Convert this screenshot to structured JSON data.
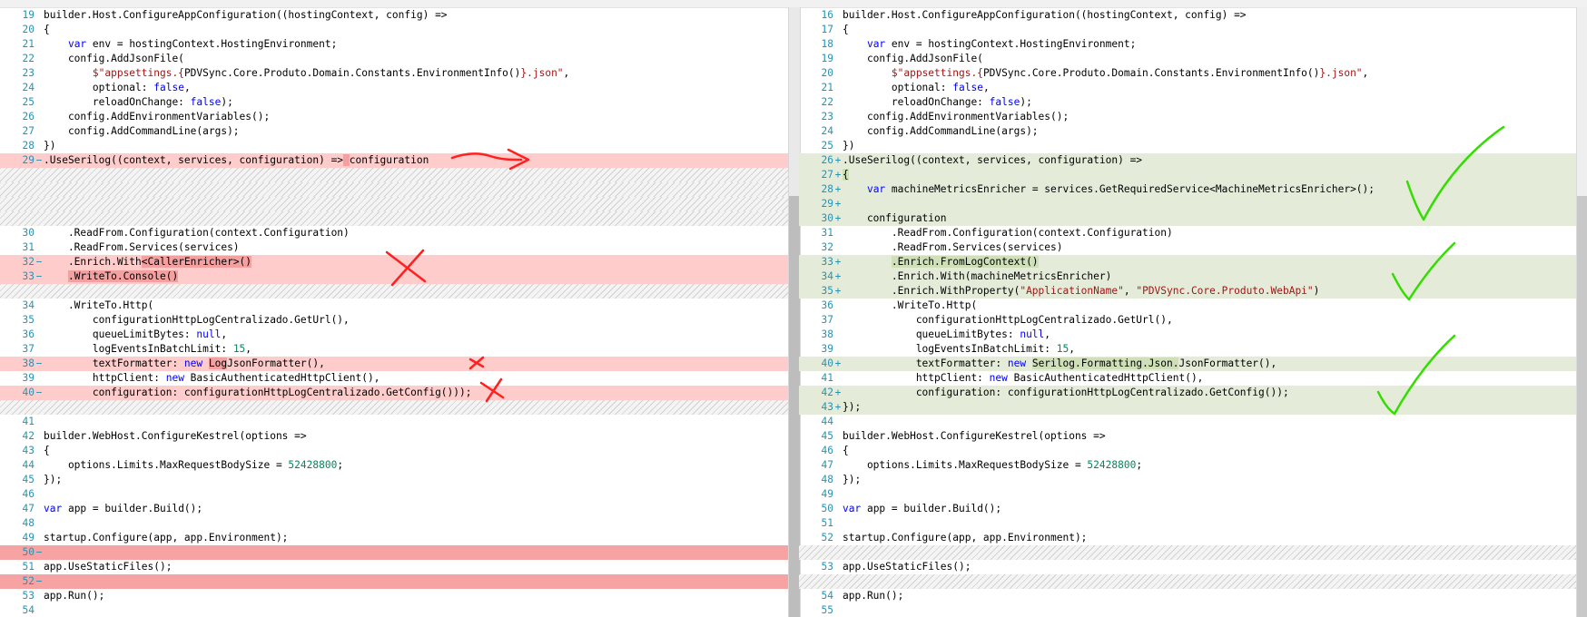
{
  "colors": {
    "deleted_line": "#ffcccc",
    "deleted_empty_line": "#f8a3a3",
    "added_line": "#e4ecd9",
    "line_number": "#2b91af",
    "keyword": "#0000ff",
    "string": "#a31515",
    "number": "#098658",
    "annotation_red": "#ff2020",
    "annotation_green": "#33dd00"
  },
  "icons": {
    "annotations": [
      "arrow-annotation-icon",
      "x-mark-annotation-icon",
      "check-mark-annotation-icon"
    ]
  },
  "left_pane": {
    "rows": [
      {
        "n": "19",
        "m": "",
        "type": "ctx",
        "segs": [
          [
            "p",
            "builder.Host.ConfigureAppConfiguration((hostingContext, config) =>"
          ]
        ]
      },
      {
        "n": "20",
        "m": "",
        "type": "ctx",
        "segs": [
          [
            "p",
            "{"
          ]
        ]
      },
      {
        "n": "21",
        "m": "",
        "type": "ctx",
        "segs": [
          [
            "p",
            "    "
          ],
          [
            "kw",
            "var"
          ],
          [
            "p",
            " env = hostingContext.HostingEnvironment;"
          ]
        ]
      },
      {
        "n": "22",
        "m": "",
        "type": "ctx",
        "segs": [
          [
            "p",
            "    config.AddJsonFile("
          ]
        ]
      },
      {
        "n": "23",
        "m": "",
        "type": "ctx",
        "segs": [
          [
            "p",
            "        "
          ],
          [
            "str",
            "$\"appsettings.{"
          ],
          [
            "p",
            "PDVSync.Core.Produto.Domain.Constants.EnvironmentInfo()"
          ],
          [
            "str",
            "}.json\""
          ],
          [
            "p",
            ","
          ]
        ]
      },
      {
        "n": "24",
        "m": "",
        "type": "ctx",
        "segs": [
          [
            "p",
            "        optional: "
          ],
          [
            "kw",
            "false"
          ],
          [
            "p",
            ","
          ]
        ]
      },
      {
        "n": "25",
        "m": "",
        "type": "ctx",
        "segs": [
          [
            "p",
            "        reloadOnChange: "
          ],
          [
            "kw",
            "false"
          ],
          [
            "p",
            ");"
          ]
        ]
      },
      {
        "n": "26",
        "m": "",
        "type": "ctx",
        "segs": [
          [
            "p",
            "    config.AddEnvironmentVariables();"
          ]
        ]
      },
      {
        "n": "27",
        "m": "",
        "type": "ctx",
        "segs": [
          [
            "p",
            "    config.AddCommandLine(args);"
          ]
        ]
      },
      {
        "n": "28",
        "m": "",
        "type": "ctx",
        "segs": [
          [
            "p",
            "})"
          ]
        ]
      },
      {
        "n": "29",
        "m": "−",
        "type": "del",
        "segs": [
          [
            "p",
            ".UseSerilog((context, services, configuration) =>"
          ],
          [
            "hd",
            " "
          ],
          [
            "p",
            "configuration"
          ]
        ]
      },
      {
        "n": "",
        "m": "",
        "type": "hatch",
        "segs": []
      },
      {
        "n": "",
        "m": "",
        "type": "hatch",
        "segs": []
      },
      {
        "n": "",
        "m": "",
        "type": "hatch",
        "segs": []
      },
      {
        "n": "",
        "m": "",
        "type": "hatch",
        "segs": []
      },
      {
        "n": "30",
        "m": "",
        "type": "ctx",
        "segs": [
          [
            "p",
            "    .ReadFrom.Configuration(context.Configuration)"
          ]
        ]
      },
      {
        "n": "31",
        "m": "",
        "type": "ctx",
        "segs": [
          [
            "p",
            "    .ReadFrom.Services(services)"
          ]
        ]
      },
      {
        "n": "32",
        "m": "−",
        "type": "del",
        "segs": [
          [
            "p",
            "    .Enrich.With"
          ],
          [
            "hd",
            "<CallerEnricher>()"
          ]
        ]
      },
      {
        "n": "33",
        "m": "−",
        "type": "del",
        "segs": [
          [
            "p",
            "    "
          ],
          [
            "hd",
            ".WriteTo.Console()"
          ]
        ]
      },
      {
        "n": "",
        "m": "",
        "type": "hatch",
        "segs": []
      },
      {
        "n": "34",
        "m": "",
        "type": "ctx",
        "segs": [
          [
            "p",
            "    .WriteTo.Http("
          ]
        ]
      },
      {
        "n": "35",
        "m": "",
        "type": "ctx",
        "segs": [
          [
            "p",
            "        configurationHttpLogCentralizado.GetUrl(),"
          ]
        ]
      },
      {
        "n": "36",
        "m": "",
        "type": "ctx",
        "segs": [
          [
            "p",
            "        queueLimitBytes: "
          ],
          [
            "kw",
            "null"
          ],
          [
            "p",
            ","
          ]
        ]
      },
      {
        "n": "37",
        "m": "",
        "type": "ctx",
        "segs": [
          [
            "p",
            "        logEventsInBatchLimit: "
          ],
          [
            "num",
            "15"
          ],
          [
            "p",
            ","
          ]
        ]
      },
      {
        "n": "38",
        "m": "−",
        "type": "del",
        "segs": [
          [
            "p",
            "        textFormatter: "
          ],
          [
            "kw",
            "new"
          ],
          [
            "p",
            " "
          ],
          [
            "hd",
            "Log"
          ],
          [
            "p",
            "JsonFormatter(),"
          ]
        ]
      },
      {
        "n": "39",
        "m": "",
        "type": "ctx",
        "segs": [
          [
            "p",
            "        httpClient: "
          ],
          [
            "kw",
            "new"
          ],
          [
            "p",
            " BasicAuthenticatedHttpClient(),"
          ]
        ]
      },
      {
        "n": "40",
        "m": "−",
        "type": "del",
        "segs": [
          [
            "p",
            "        configuration: configurationHttpLogCentralizado.GetConfig()));"
          ]
        ]
      },
      {
        "n": "",
        "m": "",
        "type": "hatch",
        "segs": []
      },
      {
        "n": "41",
        "m": "",
        "type": "ctx",
        "segs": []
      },
      {
        "n": "42",
        "m": "",
        "type": "ctx",
        "segs": [
          [
            "p",
            "builder.WebHost.ConfigureKestrel(options =>"
          ]
        ]
      },
      {
        "n": "43",
        "m": "",
        "type": "ctx",
        "segs": [
          [
            "p",
            "{"
          ]
        ]
      },
      {
        "n": "44",
        "m": "",
        "type": "ctx",
        "segs": [
          [
            "p",
            "    options.Limits.MaxRequestBodySize = "
          ],
          [
            "num",
            "52428800"
          ],
          [
            "p",
            ";"
          ]
        ]
      },
      {
        "n": "45",
        "m": "",
        "type": "ctx",
        "segs": [
          [
            "p",
            "});"
          ]
        ]
      },
      {
        "n": "46",
        "m": "",
        "type": "ctx",
        "segs": []
      },
      {
        "n": "47",
        "m": "",
        "type": "ctx",
        "segs": [
          [
            "kw",
            "var"
          ],
          [
            "p",
            " app = builder.Build();"
          ]
        ]
      },
      {
        "n": "48",
        "m": "",
        "type": "ctx",
        "segs": []
      },
      {
        "n": "49",
        "m": "",
        "type": "ctx",
        "segs": [
          [
            "p",
            "startup.Configure(app, app.Environment);"
          ]
        ]
      },
      {
        "n": "50",
        "m": "−",
        "type": "delempty",
        "segs": []
      },
      {
        "n": "51",
        "m": "",
        "type": "ctx",
        "segs": [
          [
            "p",
            "app.UseStaticFiles();"
          ]
        ]
      },
      {
        "n": "52",
        "m": "−",
        "type": "delempty",
        "segs": []
      },
      {
        "n": "53",
        "m": "",
        "type": "ctx",
        "segs": [
          [
            "p",
            "app.Run();"
          ]
        ]
      },
      {
        "n": "54",
        "m": "",
        "type": "ctx",
        "segs": []
      }
    ]
  },
  "right_pane": {
    "rows": [
      {
        "n": "16",
        "m": "",
        "type": "ctx",
        "segs": [
          [
            "p",
            "builder.Host.ConfigureAppConfiguration((hostingContext, config) =>"
          ]
        ]
      },
      {
        "n": "17",
        "m": "",
        "type": "ctx",
        "segs": [
          [
            "p",
            "{"
          ]
        ]
      },
      {
        "n": "18",
        "m": "",
        "type": "ctx",
        "segs": [
          [
            "p",
            "    "
          ],
          [
            "kw",
            "var"
          ],
          [
            "p",
            " env = hostingContext.HostingEnvironment;"
          ]
        ]
      },
      {
        "n": "19",
        "m": "",
        "type": "ctx",
        "segs": [
          [
            "p",
            "    config.AddJsonFile("
          ]
        ]
      },
      {
        "n": "20",
        "m": "",
        "type": "ctx",
        "segs": [
          [
            "p",
            "        "
          ],
          [
            "str",
            "$\"appsettings.{"
          ],
          [
            "p",
            "PDVSync.Core.Produto.Domain.Constants.EnvironmentInfo()"
          ],
          [
            "str",
            "}.json\""
          ],
          [
            "p",
            ","
          ]
        ]
      },
      {
        "n": "21",
        "m": "",
        "type": "ctx",
        "segs": [
          [
            "p",
            "        optional: "
          ],
          [
            "kw",
            "false"
          ],
          [
            "p",
            ","
          ]
        ]
      },
      {
        "n": "22",
        "m": "",
        "type": "ctx",
        "segs": [
          [
            "p",
            "        reloadOnChange: "
          ],
          [
            "kw",
            "false"
          ],
          [
            "p",
            ");"
          ]
        ]
      },
      {
        "n": "23",
        "m": "",
        "type": "ctx",
        "segs": [
          [
            "p",
            "    config.AddEnvironmentVariables();"
          ]
        ]
      },
      {
        "n": "24",
        "m": "",
        "type": "ctx",
        "segs": [
          [
            "p",
            "    config.AddCommandLine(args);"
          ]
        ]
      },
      {
        "n": "25",
        "m": "",
        "type": "ctx",
        "segs": [
          [
            "p",
            "})"
          ]
        ]
      },
      {
        "n": "26",
        "m": "+",
        "type": "add",
        "segs": [
          [
            "p",
            ".UseSerilog((context, services, configuration) =>"
          ]
        ]
      },
      {
        "n": "27",
        "m": "+",
        "type": "add",
        "segs": [
          [
            "ha",
            "{"
          ]
        ]
      },
      {
        "n": "28",
        "m": "+",
        "type": "add",
        "segs": [
          [
            "p",
            "    "
          ],
          [
            "kw",
            "var"
          ],
          [
            "p",
            " machineMetricsEnricher = services.GetRequiredService<MachineMetricsEnricher>();"
          ]
        ]
      },
      {
        "n": "29",
        "m": "+",
        "type": "add",
        "segs": []
      },
      {
        "n": "30",
        "m": "+",
        "type": "add",
        "segs": [
          [
            "p",
            "    configuration"
          ]
        ]
      },
      {
        "n": "31",
        "m": "",
        "type": "ctx",
        "segs": [
          [
            "p",
            "        .ReadFrom.Configuration(context.Configuration)"
          ]
        ]
      },
      {
        "n": "32",
        "m": "",
        "type": "ctx",
        "segs": [
          [
            "p",
            "        .ReadFrom.Services(services)"
          ]
        ]
      },
      {
        "n": "33",
        "m": "+",
        "type": "add",
        "segs": [
          [
            "p",
            "        "
          ],
          [
            "ha",
            ".Enrich.FromLogContext()"
          ]
        ]
      },
      {
        "n": "34",
        "m": "+",
        "type": "add",
        "segs": [
          [
            "p",
            "        .Enrich.With(machineMetricsEnricher)"
          ]
        ]
      },
      {
        "n": "35",
        "m": "+",
        "type": "add",
        "segs": [
          [
            "p",
            "        .Enrich.WithProperty("
          ],
          [
            "str",
            "\"ApplicationName\""
          ],
          [
            "p",
            ", "
          ],
          [
            "str",
            "\"PDVSync.Core.Produto.WebApi\""
          ],
          [
            "p",
            ")"
          ]
        ]
      },
      {
        "n": "36",
        "m": "",
        "type": "ctx",
        "segs": [
          [
            "p",
            "        .WriteTo.Http("
          ]
        ]
      },
      {
        "n": "37",
        "m": "",
        "type": "ctx",
        "segs": [
          [
            "p",
            "            configurationHttpLogCentralizado.GetUrl(),"
          ]
        ]
      },
      {
        "n": "38",
        "m": "",
        "type": "ctx",
        "segs": [
          [
            "p",
            "            queueLimitBytes: "
          ],
          [
            "kw",
            "null"
          ],
          [
            "p",
            ","
          ]
        ]
      },
      {
        "n": "39",
        "m": "",
        "type": "ctx",
        "segs": [
          [
            "p",
            "            logEventsInBatchLimit: "
          ],
          [
            "num",
            "15"
          ],
          [
            "p",
            ","
          ]
        ]
      },
      {
        "n": "40",
        "m": "+",
        "type": "add",
        "segs": [
          [
            "p",
            "            textFormatter: "
          ],
          [
            "kw",
            "new"
          ],
          [
            "p",
            " "
          ],
          [
            "ha",
            "Serilog.Formatting.Json."
          ],
          [
            "p",
            "JsonFormatter(),"
          ]
        ]
      },
      {
        "n": "41",
        "m": "",
        "type": "ctx",
        "segs": [
          [
            "p",
            "            httpClient: "
          ],
          [
            "kw",
            "new"
          ],
          [
            "p",
            " BasicAuthenticatedHttpClient(),"
          ]
        ]
      },
      {
        "n": "42",
        "m": "+",
        "type": "add",
        "segs": [
          [
            "p",
            "            configuration: configurationHttpLogCentralizado.GetConfig());"
          ]
        ]
      },
      {
        "n": "43",
        "m": "+",
        "type": "add",
        "segs": [
          [
            "p",
            "});"
          ]
        ]
      },
      {
        "n": "44",
        "m": "",
        "type": "ctx",
        "segs": []
      },
      {
        "n": "45",
        "m": "",
        "type": "ctx",
        "segs": [
          [
            "p",
            "builder.WebHost.ConfigureKestrel(options =>"
          ]
        ]
      },
      {
        "n": "46",
        "m": "",
        "type": "ctx",
        "segs": [
          [
            "p",
            "{"
          ]
        ]
      },
      {
        "n": "47",
        "m": "",
        "type": "ctx",
        "segs": [
          [
            "p",
            "    options.Limits.MaxRequestBodySize = "
          ],
          [
            "num",
            "52428800"
          ],
          [
            "p",
            ";"
          ]
        ]
      },
      {
        "n": "48",
        "m": "",
        "type": "ctx",
        "segs": [
          [
            "p",
            "});"
          ]
        ]
      },
      {
        "n": "49",
        "m": "",
        "type": "ctx",
        "segs": []
      },
      {
        "n": "50",
        "m": "",
        "type": "ctx",
        "segs": [
          [
            "kw",
            "var"
          ],
          [
            "p",
            " app = builder.Build();"
          ]
        ]
      },
      {
        "n": "51",
        "m": "",
        "type": "ctx",
        "segs": []
      },
      {
        "n": "52",
        "m": "",
        "type": "ctx",
        "segs": [
          [
            "p",
            "startup.Configure(app, app.Environment);"
          ]
        ]
      },
      {
        "n": "",
        "m": "",
        "type": "hatch",
        "segs": []
      },
      {
        "n": "53",
        "m": "",
        "type": "ctx",
        "segs": [
          [
            "p",
            "app.UseStaticFiles();"
          ]
        ]
      },
      {
        "n": "",
        "m": "",
        "type": "hatch",
        "segs": []
      },
      {
        "n": "54",
        "m": "",
        "type": "ctx",
        "segs": [
          [
            "p",
            "app.Run();"
          ]
        ]
      },
      {
        "n": "55",
        "m": "",
        "type": "ctx",
        "segs": []
      }
    ]
  }
}
